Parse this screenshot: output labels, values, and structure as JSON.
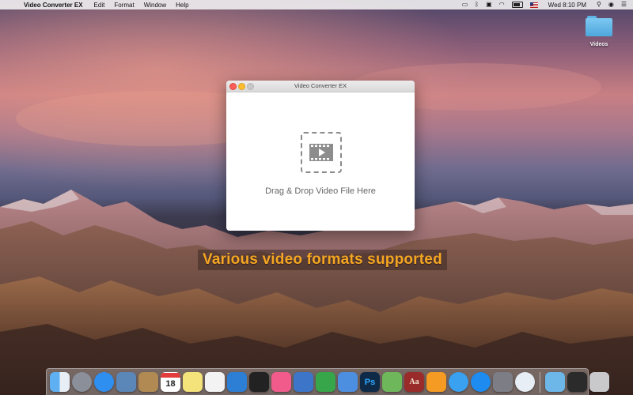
{
  "menubar": {
    "app_name": "Video Converter EX",
    "menus": [
      "Edit",
      "Format",
      "Window",
      "Help"
    ],
    "clock": "Wed 8:10 PM"
  },
  "desktop": {
    "folder_label": "Videos"
  },
  "window": {
    "title": "Video Converter EX",
    "drop_text": "Drag & Drop Video File Here"
  },
  "caption": "Various video formats supported",
  "dock": {
    "calendar_day": "18",
    "photoshop_label": "Ps",
    "dictionary_label": "Aa",
    "apps": [
      {
        "name": "finder",
        "color": "#3b8ee6"
      },
      {
        "name": "launchpad",
        "color": "#8a8f9a"
      },
      {
        "name": "safari",
        "color": "#2f8ff0"
      },
      {
        "name": "preview",
        "color": "#5a86b8"
      },
      {
        "name": "notes-book",
        "color": "#b08a52"
      },
      {
        "name": "calendar",
        "color": "#ffffff"
      },
      {
        "name": "notes",
        "color": "#f4e27a"
      },
      {
        "name": "reminders",
        "color": "#f3f3f3"
      },
      {
        "name": "xcode",
        "color": "#2d7fd6"
      },
      {
        "name": "terminal",
        "color": "#222222"
      },
      {
        "name": "itunes",
        "color": "#f05b8c"
      },
      {
        "name": "keynote",
        "color": "#3d76c9"
      },
      {
        "name": "numbers",
        "color": "#37a64a"
      },
      {
        "name": "keynote-present",
        "color": "#4c8fe0"
      },
      {
        "name": "photoshop",
        "color": "#0e2a47"
      },
      {
        "name": "maps",
        "color": "#6fb75b"
      },
      {
        "name": "dictionary",
        "color": "#9a2b2b"
      },
      {
        "name": "ibooks",
        "color": "#f59a23"
      },
      {
        "name": "messages",
        "color": "#3aa0f0"
      },
      {
        "name": "app-store",
        "color": "#1d8bf0"
      },
      {
        "name": "system-preferences",
        "color": "#7d7d85"
      },
      {
        "name": "zoom-z",
        "color": "#e8eef6"
      }
    ],
    "tail": [
      {
        "name": "downloads-folder",
        "color": "#6cb7e8"
      },
      {
        "name": "converter-window",
        "color": "#2b2b2b"
      },
      {
        "name": "trash",
        "color": "#c9c9cc"
      }
    ]
  }
}
